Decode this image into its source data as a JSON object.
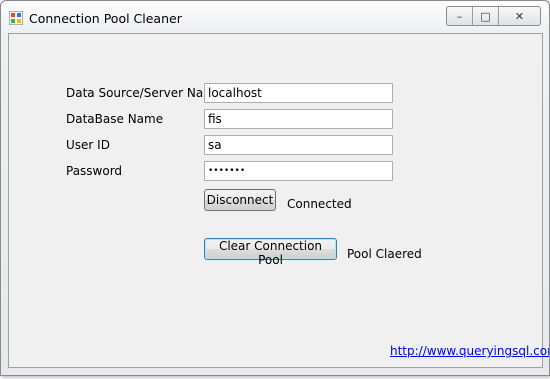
{
  "window": {
    "title": "Connection Pool Cleaner",
    "icon": "app-window-icon",
    "controls": {
      "minimize": "–",
      "maximize": "□",
      "close": "✕"
    }
  },
  "form": {
    "fields": [
      {
        "label": "Data Source/Server Name",
        "value": "localhost"
      },
      {
        "label": "DataBase Name",
        "value": "fis"
      },
      {
        "label": "User ID",
        "value": "sa"
      },
      {
        "label": "Password",
        "value": "•••••••"
      }
    ],
    "disconnect_label": "Disconnect",
    "connection_status": "Connected",
    "clear_pool_label": "Clear Connection Pool",
    "pool_status": "Pool Claered"
  },
  "footer": {
    "link_text": "http://www.queryingsql.com"
  },
  "colors": {
    "link": "#0000ff",
    "client_bg": "#f0f0f0",
    "focus_border": "#3c7fb1"
  }
}
